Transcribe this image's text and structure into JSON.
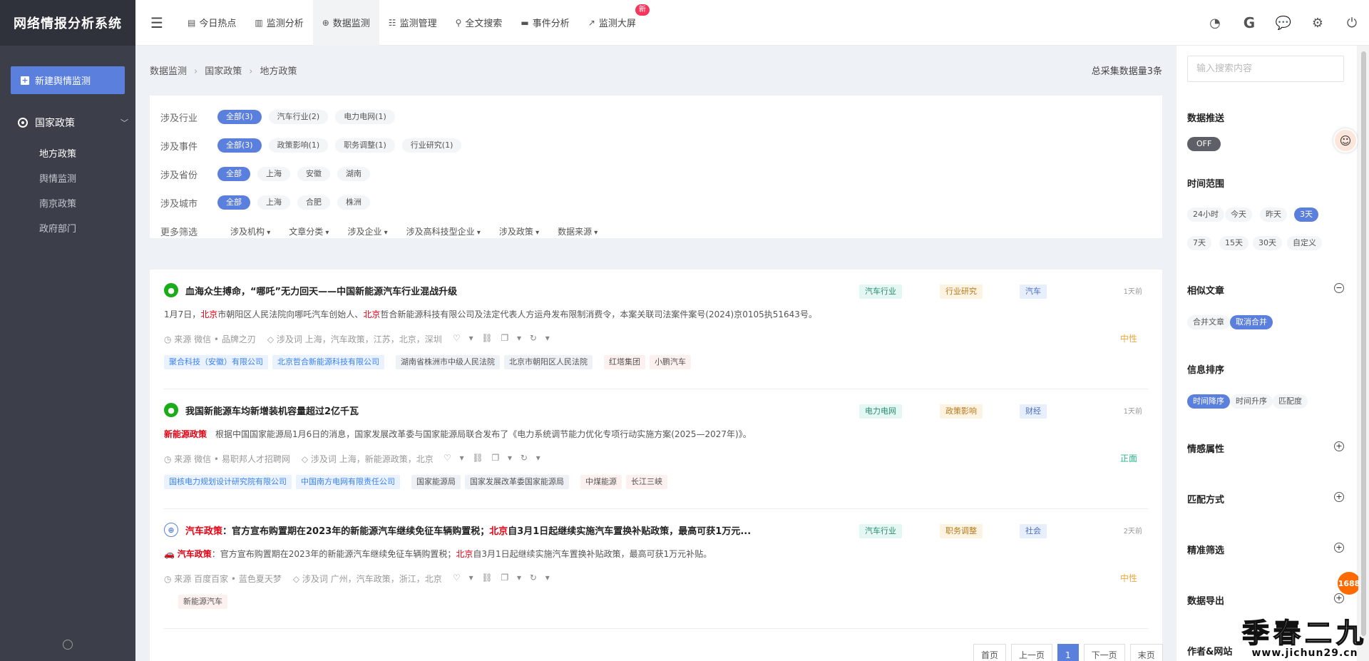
{
  "app": {
    "title": "网络情报分析系统"
  },
  "sidebar": {
    "new_button": "新建舆情监测",
    "group": "国家政策",
    "items": [
      {
        "label": "地方政策",
        "active": true
      },
      {
        "label": "舆情监测"
      },
      {
        "label": "南京政策"
      },
      {
        "label": "政府部门"
      }
    ]
  },
  "nav": {
    "items": [
      {
        "label": "今日热点",
        "icon": "list-icon"
      },
      {
        "label": "监测分析",
        "icon": "bar-chart-icon"
      },
      {
        "label": "数据监测",
        "icon": "crosshair-icon",
        "active": true
      },
      {
        "label": "监测管理",
        "icon": "list-manage-icon"
      },
      {
        "label": "全文搜索",
        "icon": "search-icon"
      },
      {
        "label": "事件分析",
        "icon": "card-icon"
      },
      {
        "label": "监测大屏",
        "icon": "trend-icon",
        "badge": "新"
      }
    ],
    "right_icons": [
      "palette-icon",
      "g-logo-icon",
      "chat-icon",
      "gear-icon",
      "power-icon"
    ]
  },
  "breadcrumb": [
    "数据监测",
    "国家政策",
    "地方政策"
  ],
  "total": "总采集数据量3条",
  "filters": {
    "rows": [
      {
        "label": "涉及行业",
        "tags": [
          "全部(3)",
          "汽车行业(2)",
          "电力电网(1)"
        ]
      },
      {
        "label": "涉及事件",
        "tags": [
          "全部(3)",
          "政策影响(1)",
          "职务调整(1)",
          "行业研究(1)"
        ]
      },
      {
        "label": "涉及省份",
        "tags": [
          "全部",
          "上海",
          "安徽",
          "湖南"
        ]
      },
      {
        "label": "涉及城市",
        "tags": [
          "全部",
          "上海",
          "合肥",
          "株洲"
        ]
      }
    ],
    "more_label": "更多筛选",
    "dropdowns": [
      "涉及机构",
      "文章分类",
      "涉及企业",
      "涉及高科技型企业",
      "涉及政策",
      "数据来源"
    ]
  },
  "articles": [
    {
      "title": "血海众生搏命，“哪吒”无力回天——中国新能源汽车行业混战升级",
      "summary": {
        "p1": "1月7日，",
        "k1": "北京",
        "p2": "市朝阳区人民法院向哪吒汽车创始人、",
        "k2": "北京",
        "p3": "哲合新能源科技有限公司及法定代表人方运舟发布限制消费令，本案关联司法案件案号(2024)京0105执51643号。"
      },
      "source": "来源 微信 • 品牌之刃",
      "keywords": "涉及词 上海，汽车政策，江苏，北京，深圳",
      "chips_blue": [
        "聚合科技（安徽）有限公司",
        "北京哲合新能源科技有限公司"
      ],
      "chips_grey": [
        "湖南省株洲市中级人民法院",
        "北京市朝阳区人民法院"
      ],
      "chips_pink": [
        "红塔集团",
        "小鹏汽车"
      ],
      "cats": [
        "汽车行业",
        "行业研究",
        "汽车"
      ],
      "ago": "1天前",
      "sentiment": "中性"
    },
    {
      "title": "我国新能源车均新增装机容量超过2亿千瓦",
      "summary": {
        "k0": "新能源政策",
        "p1": "根据中国国家能源局1月6日的消息，国家发展改革委与国家能源局联合发布了《电力系统调节能力优化专项行动实施方案(2025—2027年)》。"
      },
      "source": "来源 微信 • 易职邦人才招聘网",
      "keywords": "涉及词 上海，新能源政策，北京",
      "chips_blue": [
        "国核电力规划设计研究院有限公司",
        "中国南方电网有限责任公司"
      ],
      "chips_grey": [
        "国家能源局",
        "国家发展改革委国家能源局"
      ],
      "chips_pink": [
        "中煤能源",
        "长江三峡"
      ],
      "cats": [
        "电力电网",
        "政策影响",
        "财经"
      ],
      "ago": "1天前",
      "sentiment": "正面"
    },
    {
      "title": {
        "k0": "汽车政策",
        "p1": "：官方宣布购置期在2023年的新能源汽车继续免征车辆购置税；",
        "k1": "北京",
        "p2": "自3月1日起继续实施汽车置换补贴政策，最高可获1万元..."
      },
      "summary": {
        "k0": "汽车政策",
        "p1": "：官方宣布购置期在2023年的新能源汽车继续免征车辆购置税；",
        "k1": "北京",
        "p2": "自3月1日起继续实施汽车置换补贴政策，最高可获1万元补贴。"
      },
      "source": "来源 百度百家 • 蓝色夏天梦",
      "keywords": "涉及词 广州，汽车政策，浙江，北京",
      "chips_pink": [
        "新能源汽车"
      ],
      "cats": [
        "汽车行业",
        "职务调整",
        "社会"
      ],
      "ago": "2天前",
      "sentiment": "中性"
    }
  ],
  "actions": "♡ ▾ ⛓ ❐ ▾ ↻ ▾",
  "pager": [
    "首页",
    "上一页",
    "1",
    "下一页",
    "末页"
  ],
  "right": {
    "search_placeholder": "输入搜索内容",
    "push_title": "数据推送",
    "push_state": "OFF",
    "time_title": "时间范围",
    "time_opts": [
      "24小时",
      "今天",
      "昨天",
      "3天",
      "7天",
      "15天",
      "30天",
      "自定义"
    ],
    "similar_title": "相似文章",
    "similar_opts": [
      "合并文章",
      "取消合并"
    ],
    "sort_title": "信息排序",
    "sort_opts": [
      "时间降序",
      "时间升序",
      "匹配度"
    ],
    "collapsed": [
      "情感属性",
      "匹配方式",
      "精准筛选",
      "数据导出",
      "作者&网站"
    ]
  },
  "watermark": {
    "big": "季春二九",
    "small": "www.jichun29.cn"
  },
  "float_badge": "1688"
}
